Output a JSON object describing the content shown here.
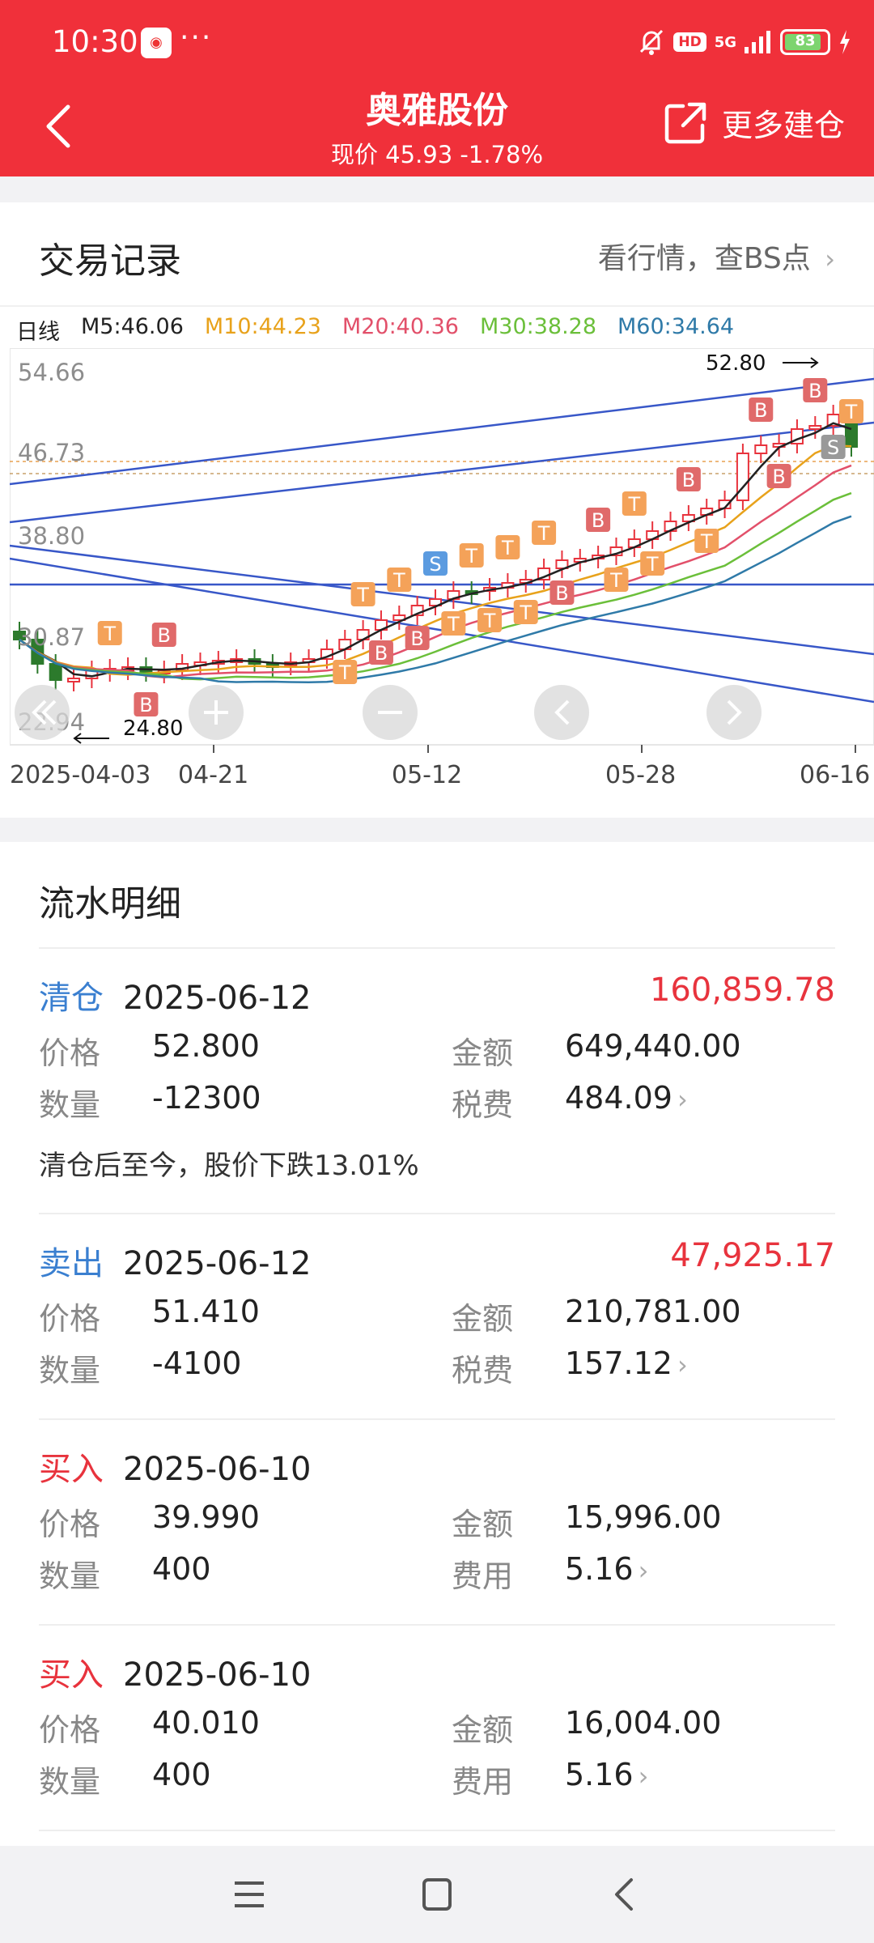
{
  "status": {
    "time": "10:30",
    "dots": "···",
    "hd": "HD",
    "net": "5G",
    "battery": "83"
  },
  "header": {
    "title": "奥雅股份",
    "subtitle": "现价 45.93 -1.78%",
    "more_label": "更多建仓"
  },
  "trade_record": {
    "title": "交易记录",
    "link": "看行情，查BS点",
    "ma": {
      "period": "日线",
      "m5": "M5:46.06",
      "m10": "M10:44.23",
      "m20": "M20:40.36",
      "m30": "M30:38.28",
      "m60": "M60:34.64"
    },
    "colors": {
      "m5": "#222222",
      "m10": "#e8a21b",
      "m20": "#e2506a",
      "m30": "#6bbf3a",
      "m60": "#2f7aa8"
    },
    "chart_data": {
      "type": "candlestick",
      "y_ticks": [
        "54.66",
        "46.73",
        "38.80",
        "30.87",
        "22.94"
      ],
      "high_label": "52.80",
      "low_label": "24.80",
      "x_ticks": [
        "2025-04-03",
        "04-21",
        "05-12",
        "05-28",
        "06-16"
      ]
    }
  },
  "flow": {
    "title": "流水明细",
    "items": [
      {
        "type": "清仓",
        "type_color": "#3a7fd0",
        "date": "2025-06-12",
        "amount": "160,859.78",
        "price_label": "价格",
        "price": "52.800",
        "total_label": "金额",
        "total": "649,440.00",
        "qty_label": "数量",
        "qty": "-12300",
        "fee_label": "税费",
        "fee": "484.09",
        "note": "清仓后至今，股价下跌13.01%"
      },
      {
        "type": "卖出",
        "type_color": "#3a7fd0",
        "date": "2025-06-12",
        "amount": "47,925.17",
        "price_label": "价格",
        "price": "51.410",
        "total_label": "金额",
        "total": "210,781.00",
        "qty_label": "数量",
        "qty": "-4100",
        "fee_label": "税费",
        "fee": "157.12"
      },
      {
        "type": "买入",
        "type_color": "#e8333d",
        "date": "2025-06-10",
        "amount": "",
        "price_label": "价格",
        "price": "39.990",
        "total_label": "金额",
        "total": "15,996.00",
        "qty_label": "数量",
        "qty": "400",
        "fee_label": "费用",
        "fee": "5.16"
      },
      {
        "type": "买入",
        "type_color": "#e8333d",
        "date": "2025-06-10",
        "amount": "",
        "price_label": "价格",
        "price": "40.010",
        "total_label": "金额",
        "total": "16,004.00",
        "qty_label": "数量",
        "qty": "400",
        "fee_label": "费用",
        "fee": "5.16"
      }
    ]
  },
  "chevron": "›"
}
